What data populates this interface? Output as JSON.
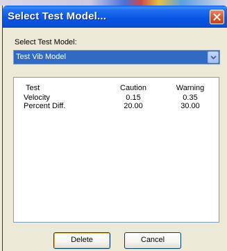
{
  "window": {
    "title": "Select Test Model..."
  },
  "select": {
    "label": "Select Test Model:",
    "value": "Test Vib Model"
  },
  "table": {
    "headers": {
      "test": "Test",
      "caution": "Caution",
      "warning": "Warning"
    },
    "rows": [
      {
        "test": "Velocity",
        "caution": "0.15",
        "warning": "0.35"
      },
      {
        "test": "Percent Diff.",
        "caution": "20.00",
        "warning": "30.00"
      }
    ]
  },
  "buttons": {
    "delete": "Delete",
    "cancel": "Cancel"
  },
  "colors": {
    "titlebar": "#0a55e3",
    "selection": "#316ac5",
    "close": "#d8572e"
  }
}
